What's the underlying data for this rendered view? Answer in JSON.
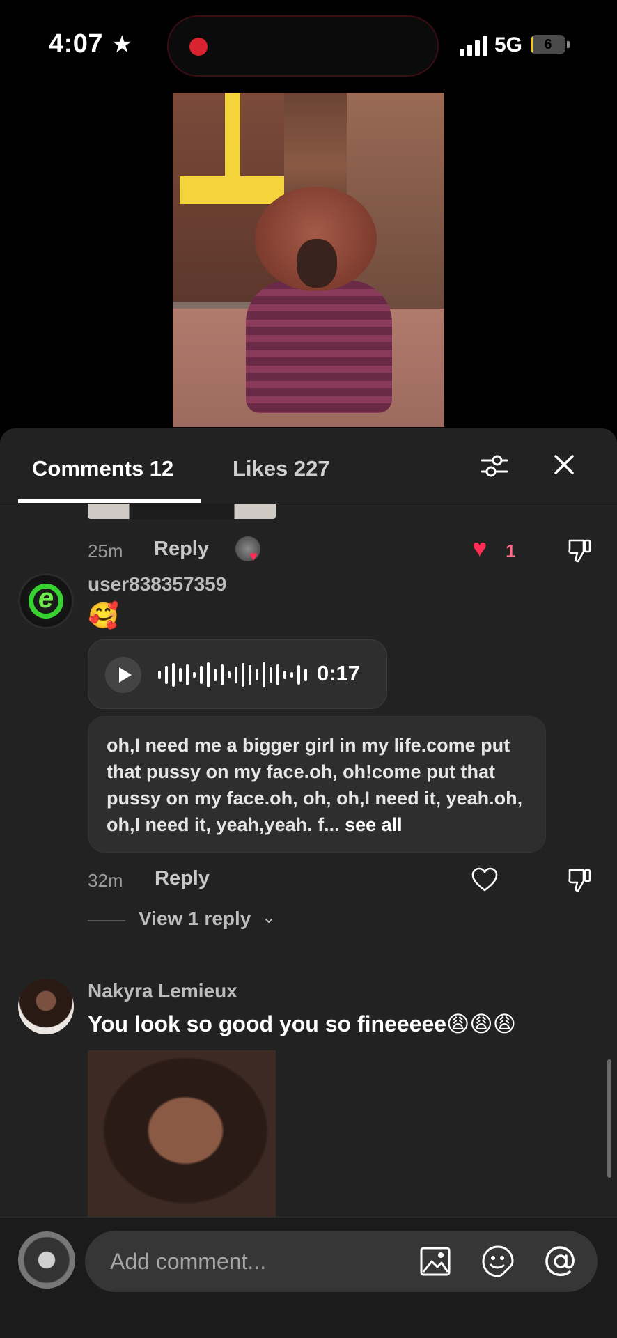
{
  "status_bar": {
    "time": "4:07",
    "network": "5G",
    "battery_level": "6"
  },
  "tabs": {
    "comments_label": "Comments 12",
    "likes_label": "Likes 227"
  },
  "prev_comment": {
    "time": "25m",
    "reply_label": "Reply",
    "like_count": "1",
    "liked": true
  },
  "comment1": {
    "username": "user838357359",
    "emoji": "🥰",
    "audio_duration": "0:17",
    "transcript": "oh,I need me a bigger girl in my life.come put that pussy on my face.oh, oh!come put that pussy on my face.oh, oh, oh,I need it, yeah.oh, oh,I need it, yeah,yeah. f...",
    "see_all_label": "see all",
    "time": "32m",
    "reply_label": "Reply",
    "view_replies_label": "View 1 reply"
  },
  "comment2": {
    "username": "Nakyra Lemieux",
    "text": "You look so good you so fineeeee😩😩😩"
  },
  "composer": {
    "placeholder": "Add comment..."
  },
  "colors": {
    "panel_bg": "#222222",
    "like_red": "#ff2d55",
    "accent_green": "#38d132"
  }
}
